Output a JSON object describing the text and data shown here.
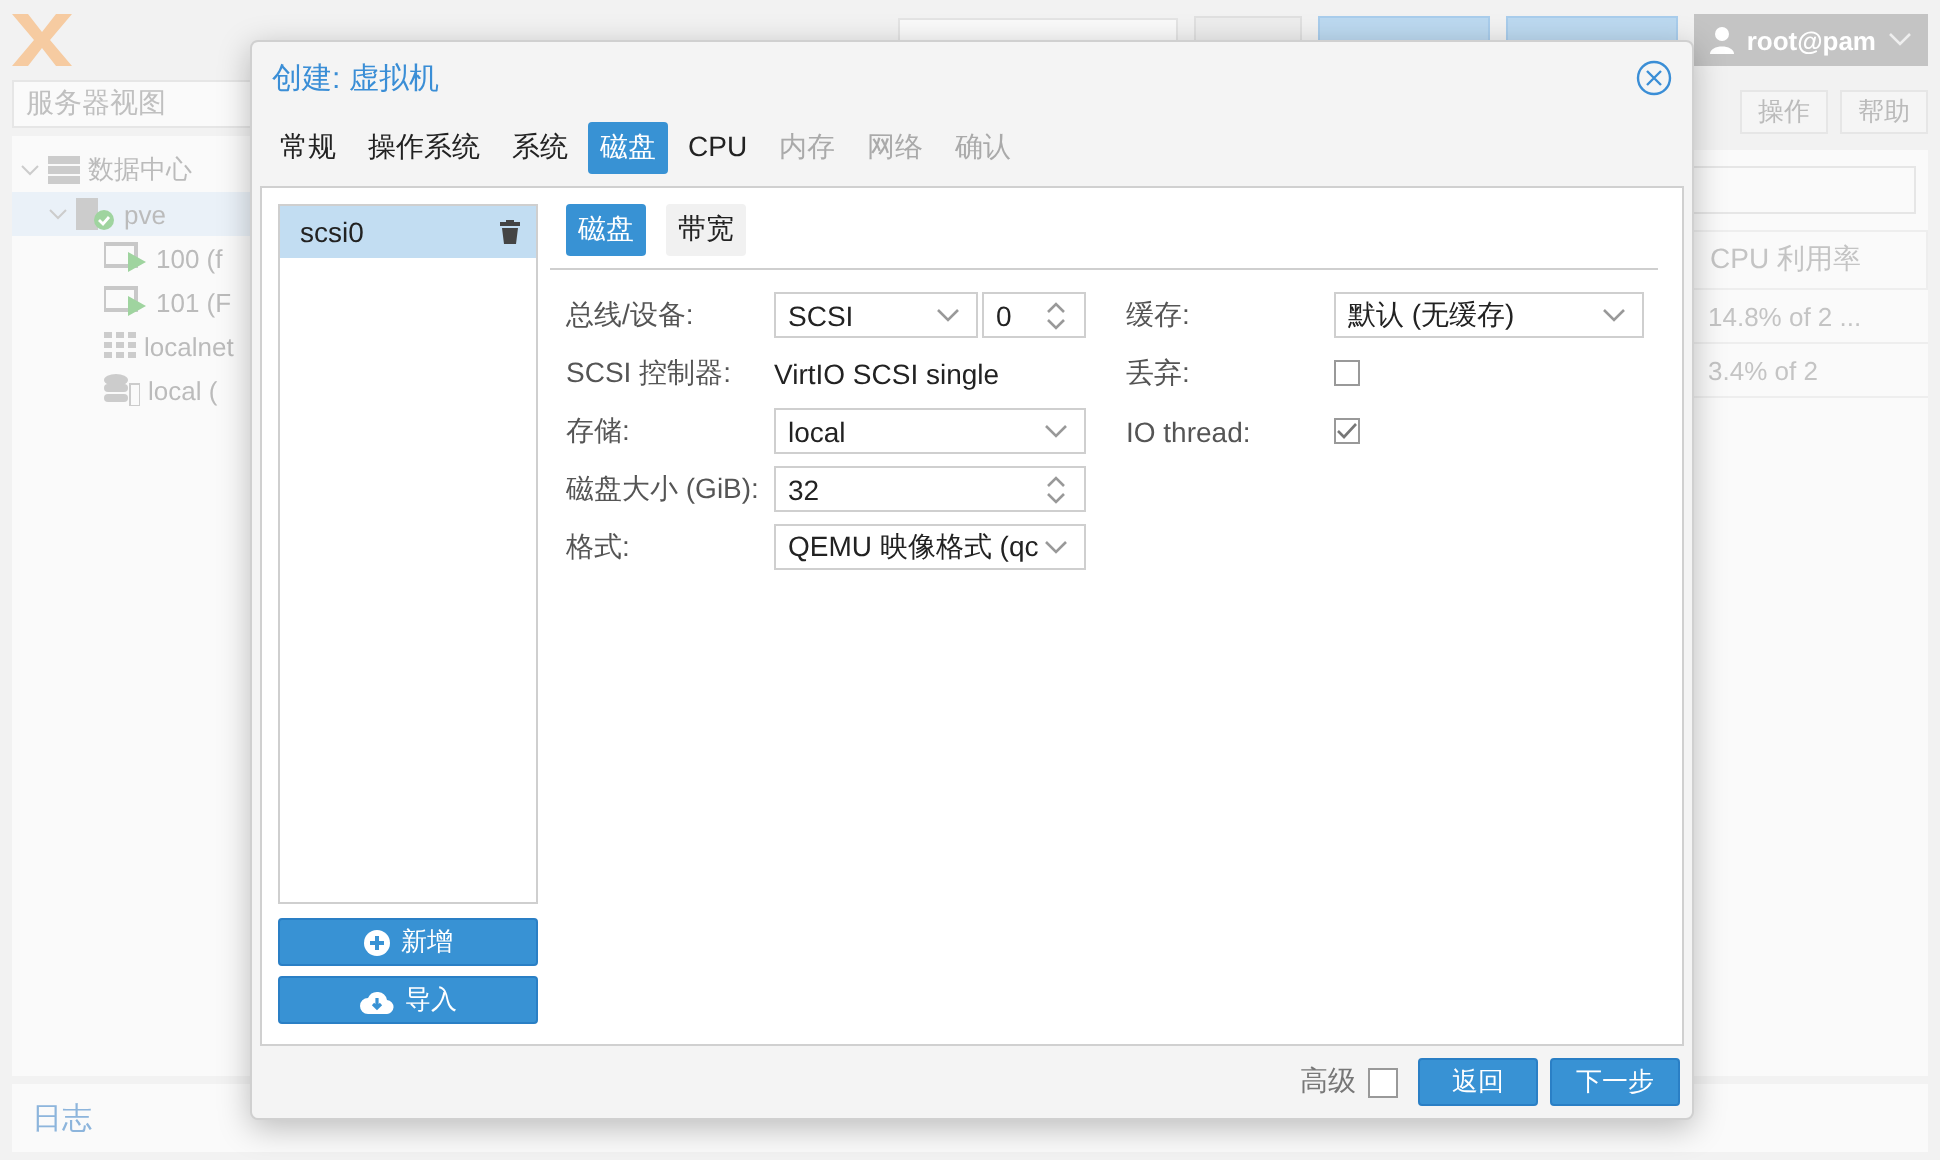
{
  "header": {
    "buttons": [
      {
        "kind": "plain"
      },
      {
        "kind": "primary"
      },
      {
        "kind": "primary"
      }
    ],
    "user": "root@pam"
  },
  "sidebar": {
    "view": "服务器视图",
    "tree": [
      {
        "label": "数据中心",
        "kind": "datacenter",
        "expanded": true,
        "selected": false,
        "children": [
          {
            "label": "pve",
            "kind": "node",
            "expanded": true,
            "selected": true,
            "children": [
              {
                "label": "100 (f",
                "kind": "vm",
                "selected": false
              },
              {
                "label": "101 (F",
                "kind": "vm",
                "selected": false
              },
              {
                "label": "localnet",
                "kind": "network",
                "selected": false
              },
              {
                "label": "local (",
                "kind": "storage",
                "selected": false
              }
            ]
          }
        ]
      }
    ]
  },
  "main": {
    "toolbar": [
      "操作",
      "帮助"
    ],
    "columns": [
      "CPU 利用率"
    ],
    "rows": [
      [
        "14.8% of 2 ..."
      ],
      [
        "3.4% of 2"
      ]
    ]
  },
  "log": {
    "title": "日志"
  },
  "dialog": {
    "title": "创建: 虚拟机",
    "tabs": [
      {
        "label": "常规",
        "selected": false,
        "disabled": false
      },
      {
        "label": "操作系统",
        "selected": false,
        "disabled": false
      },
      {
        "label": "系统",
        "selected": false,
        "disabled": false
      },
      {
        "label": "磁盘",
        "selected": true,
        "disabled": false
      },
      {
        "label": "CPU",
        "selected": false,
        "disabled": false
      },
      {
        "label": "内存",
        "selected": false,
        "disabled": true
      },
      {
        "label": "网络",
        "selected": false,
        "disabled": true
      },
      {
        "label": "确认",
        "selected": false,
        "disabled": true
      }
    ],
    "disks": [
      {
        "label": "scsi0",
        "selected": true
      }
    ],
    "disk_buttons": [
      {
        "label": "新增",
        "kind": "add"
      },
      {
        "label": "导入",
        "kind": "import"
      }
    ],
    "subtabs": [
      {
        "label": "磁盘",
        "selected": true
      },
      {
        "label": "带宽",
        "selected": false
      }
    ],
    "left_fields": [
      {
        "label": "总线/设备:",
        "controls": [
          {
            "kind": "combo",
            "value": "SCSI"
          },
          {
            "kind": "spinner",
            "value": "0"
          }
        ]
      },
      {
        "label": "SCSI 控制器:",
        "controls": [
          {
            "kind": "text",
            "value": "VirtIO SCSI single"
          }
        ]
      },
      {
        "label": "存储:",
        "controls": [
          {
            "kind": "combo",
            "value": "local"
          }
        ]
      },
      {
        "label": "磁盘大小 (GiB):",
        "controls": [
          {
            "kind": "spinner",
            "value": "32"
          }
        ]
      },
      {
        "label": "格式:",
        "controls": [
          {
            "kind": "combo",
            "value": "QEMU 映像格式 (qc"
          }
        ]
      }
    ],
    "right_fields": [
      {
        "label": "缓存:",
        "controls": [
          {
            "kind": "combo",
            "value": "默认 (无缓存)"
          }
        ]
      },
      {
        "label": "丢弃:",
        "controls": [
          {
            "kind": "checkbox",
            "checked": false
          }
        ]
      },
      {
        "label": "IO thread:",
        "controls": [
          {
            "kind": "checkbox",
            "checked": true
          }
        ]
      }
    ],
    "footer": {
      "advanced": {
        "label": "高级",
        "checked": false
      },
      "buttons": [
        "返回",
        "下一步"
      ]
    }
  }
}
